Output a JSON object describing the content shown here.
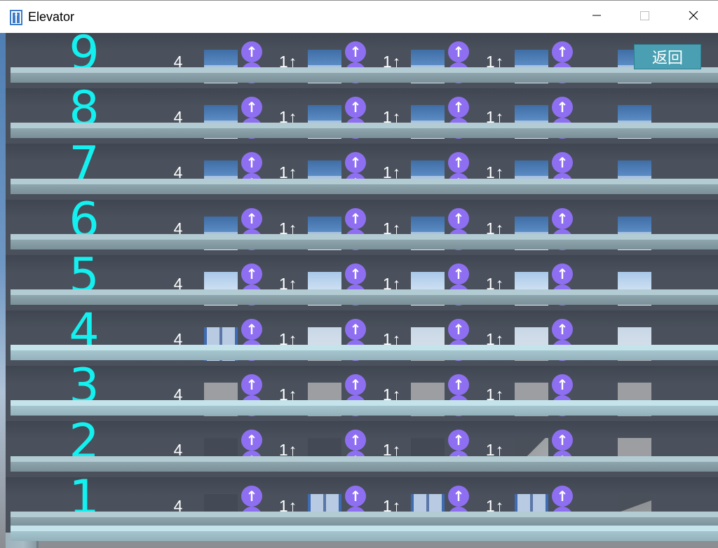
{
  "window": {
    "title": "Elevator",
    "icon": "elevator-app-icon",
    "controls": [
      "minimize-icon",
      "maximize-icon",
      "close-icon"
    ]
  },
  "back_button": {
    "label": "返回"
  },
  "colors": {
    "floor_number": "#14f0f0",
    "call_button": "#8e6ff2",
    "back_button": "#4aa0b2",
    "wall": "#4a515c"
  },
  "call_buttons": {
    "up": "↑",
    "down": "↓"
  },
  "floors": [
    {
      "number": "9",
      "count": "4",
      "shafts": [
        {
          "status": "1↑"
        },
        {
          "status": "1↑"
        },
        {
          "status": "1↑"
        }
      ]
    },
    {
      "number": "8",
      "count": "4",
      "shafts": [
        {
          "status": "1↑"
        },
        {
          "status": "1↑"
        },
        {
          "status": "1↑"
        }
      ]
    },
    {
      "number": "7",
      "count": "4",
      "shafts": [
        {
          "status": "1↑"
        },
        {
          "status": "1↑"
        },
        {
          "status": "1↑"
        }
      ]
    },
    {
      "number": "6",
      "count": "4",
      "shafts": [
        {
          "status": "1↑"
        },
        {
          "status": "1↑"
        },
        {
          "status": "1↑"
        }
      ]
    },
    {
      "number": "5",
      "count": "4",
      "shafts": [
        {
          "status": "1↑"
        },
        {
          "status": "1↑"
        },
        {
          "status": "1↑"
        }
      ]
    },
    {
      "number": "4",
      "count": "4",
      "shafts": [
        {
          "status": "1↑"
        },
        {
          "status": "1↑"
        },
        {
          "status": "1↑"
        }
      ]
    },
    {
      "number": "3",
      "count": "4",
      "shafts": [
        {
          "status": "1↑"
        },
        {
          "status": "1↑"
        },
        {
          "status": "1↑"
        }
      ]
    },
    {
      "number": "2",
      "count": "4",
      "shafts": [
        {
          "status": "1↑"
        },
        {
          "status": "1↑"
        },
        {
          "status": "1↑"
        }
      ]
    },
    {
      "number": "1",
      "count": "4",
      "shafts": [
        {
          "status": "1↑"
        },
        {
          "status": "1↑"
        },
        {
          "status": "1↑"
        }
      ]
    }
  ]
}
